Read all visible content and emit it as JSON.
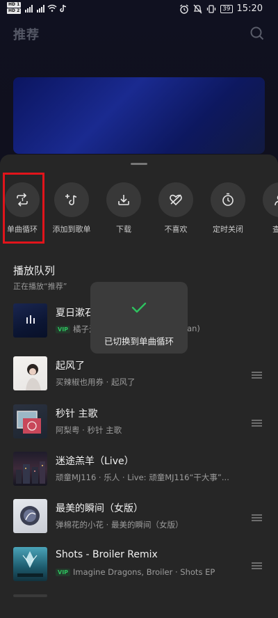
{
  "status_bar": {
    "hd1": "HD 1",
    "hd2": "HD 2",
    "network": "4G",
    "battery": "39",
    "time": "15:20"
  },
  "header": {
    "title": "推荐"
  },
  "actions": [
    {
      "label": "单曲循环",
      "icon": "repeat-one-icon"
    },
    {
      "label": "添加到歌单",
      "icon": "add-to-playlist-icon"
    },
    {
      "label": "下载",
      "icon": "download-icon"
    },
    {
      "label": "不喜欢",
      "icon": "dislike-icon"
    },
    {
      "label": "定时关闭",
      "icon": "timer-icon"
    },
    {
      "label": "查看",
      "icon": "view-icon"
    }
  ],
  "queue": {
    "title": "播放队列",
    "subtitle": "正在播放“推荐”",
    "songs": [
      {
        "title": "夏日漱石",
        "vip": true,
        "artist": "橘子海…",
        "meta_tail": "ean)"
      },
      {
        "title": "起风了",
        "vip": false,
        "artist": "买辣椒也用券 · 起风了"
      },
      {
        "title": "秒针 主歌",
        "vip": false,
        "artist": "阿梨粤 · 秒针 主歌"
      },
      {
        "title": "迷途羔羊（Live）",
        "vip": false,
        "artist": "顽童MJ116 · 乐人 · Live: 顽童MJ116“干大事”..."
      },
      {
        "title": "最美的瞬间（女版）",
        "vip": false,
        "artist": "弹棉花的小花 · 最美的瞬间（女版）"
      },
      {
        "title": "Shots - Broiler Remix",
        "vip": true,
        "artist": "Imagine Dragons, Broiler · Shots EP"
      }
    ],
    "vip_label": "VIP"
  },
  "toast": {
    "text": "已切换到单曲循环"
  },
  "colors": {
    "accent_green": "#2ec25f",
    "highlight_red": "#e1141b",
    "sheet_bg": "#262626"
  }
}
